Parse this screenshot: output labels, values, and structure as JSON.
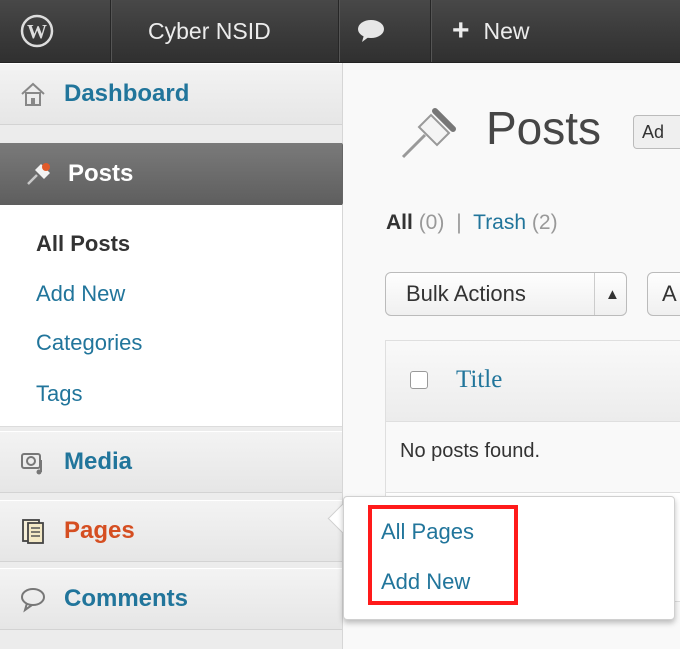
{
  "admin_bar": {
    "site_name": "Cyber NSID",
    "new_label": "New",
    "icons": [
      "wordpress-logo-icon",
      "comment-bubble-icon",
      "plus-icon"
    ]
  },
  "sidebar": {
    "dashboard": "Dashboard",
    "posts": "Posts",
    "posts_submenu": [
      "All Posts",
      "Add New",
      "Categories",
      "Tags"
    ],
    "media": "Media",
    "pages": "Pages",
    "comments": "Comments"
  },
  "main": {
    "page_title": "Posts",
    "add_new_partial": "Ad",
    "filters": {
      "all_label": "All",
      "all_count": "(0)",
      "separator": "|",
      "trash_label": "Trash",
      "trash_count": "(2)"
    },
    "bulk_actions": "Bulk Actions",
    "apply_partial": "A",
    "table": {
      "title_header": "Title",
      "empty_message": "No posts found."
    }
  },
  "flyout": {
    "items": [
      "All Pages",
      "Add New"
    ]
  },
  "colors": {
    "link": "#21759b",
    "active_menu": "#d54e21",
    "highlight": "#ff1a1a"
  }
}
